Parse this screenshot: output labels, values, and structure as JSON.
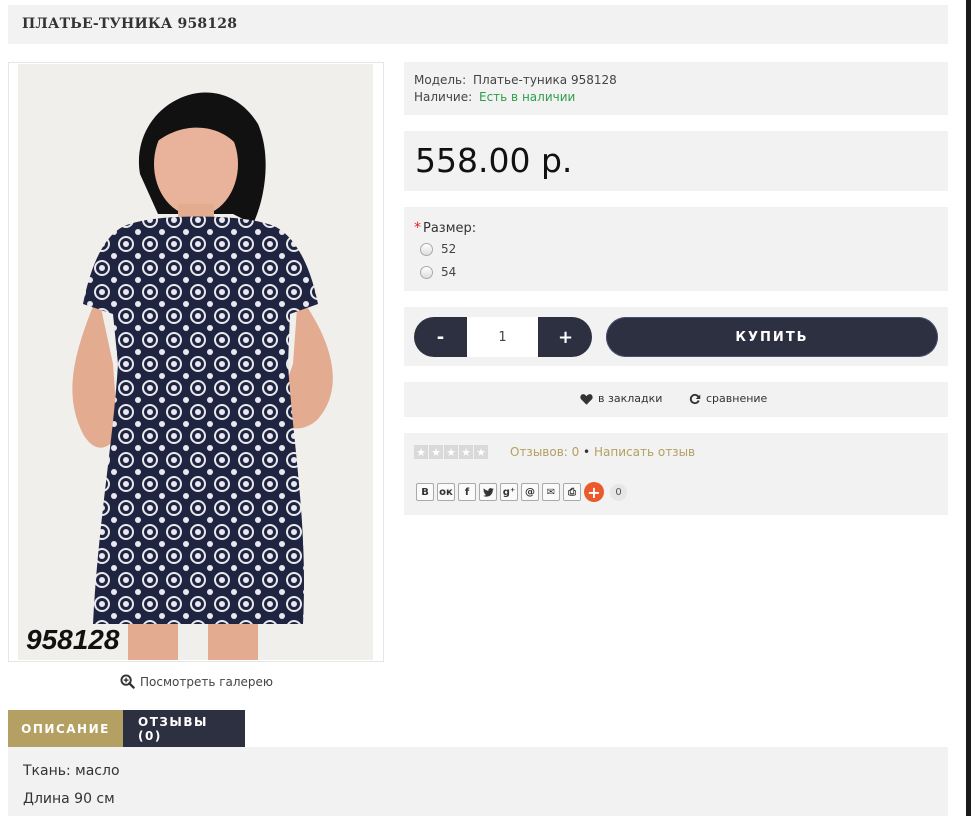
{
  "product": {
    "title": "ПЛАТЬЕ-ТУНИКА 958128",
    "model_label": "Модель:",
    "model_value": "Платье-туника 958128",
    "stock_label": "Наличие:",
    "stock_value": "Есть в наличии",
    "price": "558.00 р.",
    "image_caption": "958128"
  },
  "gallery": {
    "link_label": "Посмотреть галерею"
  },
  "options": {
    "required_mark": "*",
    "size_label": "Размер:",
    "sizes": [
      "52",
      "54"
    ]
  },
  "purchase": {
    "minus_label": "-",
    "plus_label": "+",
    "quantity": "1",
    "buy_label": "КУПИТЬ"
  },
  "actions": {
    "wishlist_label": "в закладки",
    "compare_label": "сравнение"
  },
  "reviews": {
    "rating": 0,
    "max_rating": 5,
    "count_label": "Отзывов: 0",
    "separator": "•",
    "write_label": "Написать отзыв"
  },
  "share": {
    "buttons": [
      "В",
      "ок",
      "f",
      "tw",
      "g+",
      "@",
      "mail",
      "print"
    ],
    "count": "0"
  },
  "tabs": [
    {
      "label": "ОПИСАНИЕ",
      "active": true
    },
    {
      "label": "ОТЗЫВЫ (0)",
      "active": false
    }
  ],
  "description": {
    "lines": [
      "Ткань: масло",
      "Длина 90 см"
    ]
  },
  "colors": {
    "accent_gold": "#b4a063",
    "dark_navy": "#2c3040",
    "in_stock_green": "#2e9e4a",
    "share_orange": "#ea5a2c"
  }
}
